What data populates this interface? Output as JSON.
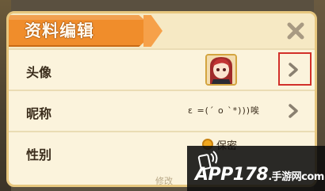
{
  "dialog": {
    "title": "资料编辑",
    "close_icon": "close-x-icon"
  },
  "rows": {
    "avatar": {
      "label": "头像",
      "arrow_icon": "chevron-right-icon"
    },
    "nickname": {
      "label": "昵称",
      "value": "ε =(´ ο `*)))唉",
      "arrow_icon": "chevron-right-icon"
    },
    "gender": {
      "label": "性别",
      "value": "保密"
    }
  },
  "footer_hint": "修改",
  "watermark": {
    "text": "APP178",
    "sub": ".手游网",
    "url": "com"
  },
  "colors": {
    "title_banner": "#f08d2b",
    "panel_bg": "#fbf3dc",
    "border": "#e7c77f",
    "highlight": "#d2302a"
  }
}
